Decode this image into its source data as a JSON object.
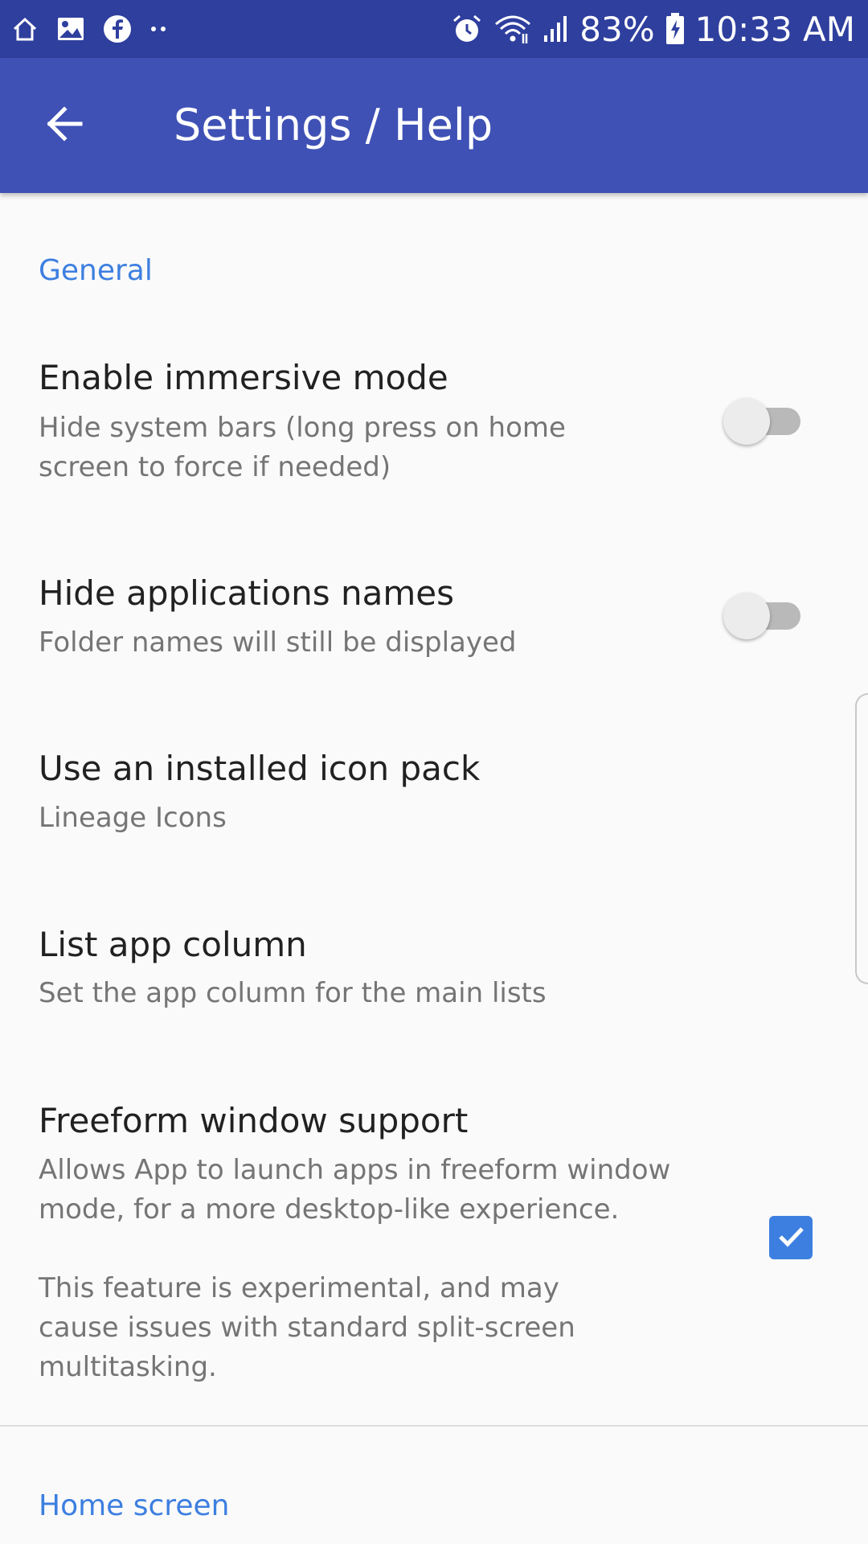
{
  "status_bar": {
    "left_icons": [
      "home-icon",
      "gallery-icon",
      "facebook-icon",
      "more-dots-icon"
    ],
    "battery_percent": "83%",
    "time": "10:33 AM"
  },
  "app_bar": {
    "title": "Settings / Help"
  },
  "sections": [
    {
      "header": "General"
    },
    {
      "header": "Home screen"
    }
  ],
  "preferences": [
    {
      "title": "Enable immersive mode",
      "summary": [
        "Hide system bars (long press on home",
        "screen to force if needed)"
      ],
      "control": "switch",
      "checked": false
    },
    {
      "title": "Hide applications names",
      "summary": [
        "Folder names will still be displayed"
      ],
      "control": "switch",
      "checked": false
    },
    {
      "title": "Use an installed icon pack",
      "summary": [
        "Lineage Icons"
      ],
      "control": "none"
    },
    {
      "title": "List app column",
      "summary": [
        "Set the app column for the main lists"
      ],
      "control": "none"
    },
    {
      "title": "Freeform window support",
      "summary": [
        "Allows App to launch apps in freeform window",
        "mode, for a more desktop-like experience.",
        "",
        "This feature is experimental, and may",
        "cause issues with standard split-screen",
        "multitasking."
      ],
      "control": "checkbox",
      "checked": true
    }
  ],
  "colors": {
    "status_bar": "#2f3f9e",
    "app_bar": "#3f51b5",
    "accent": "#3d7fe0"
  }
}
